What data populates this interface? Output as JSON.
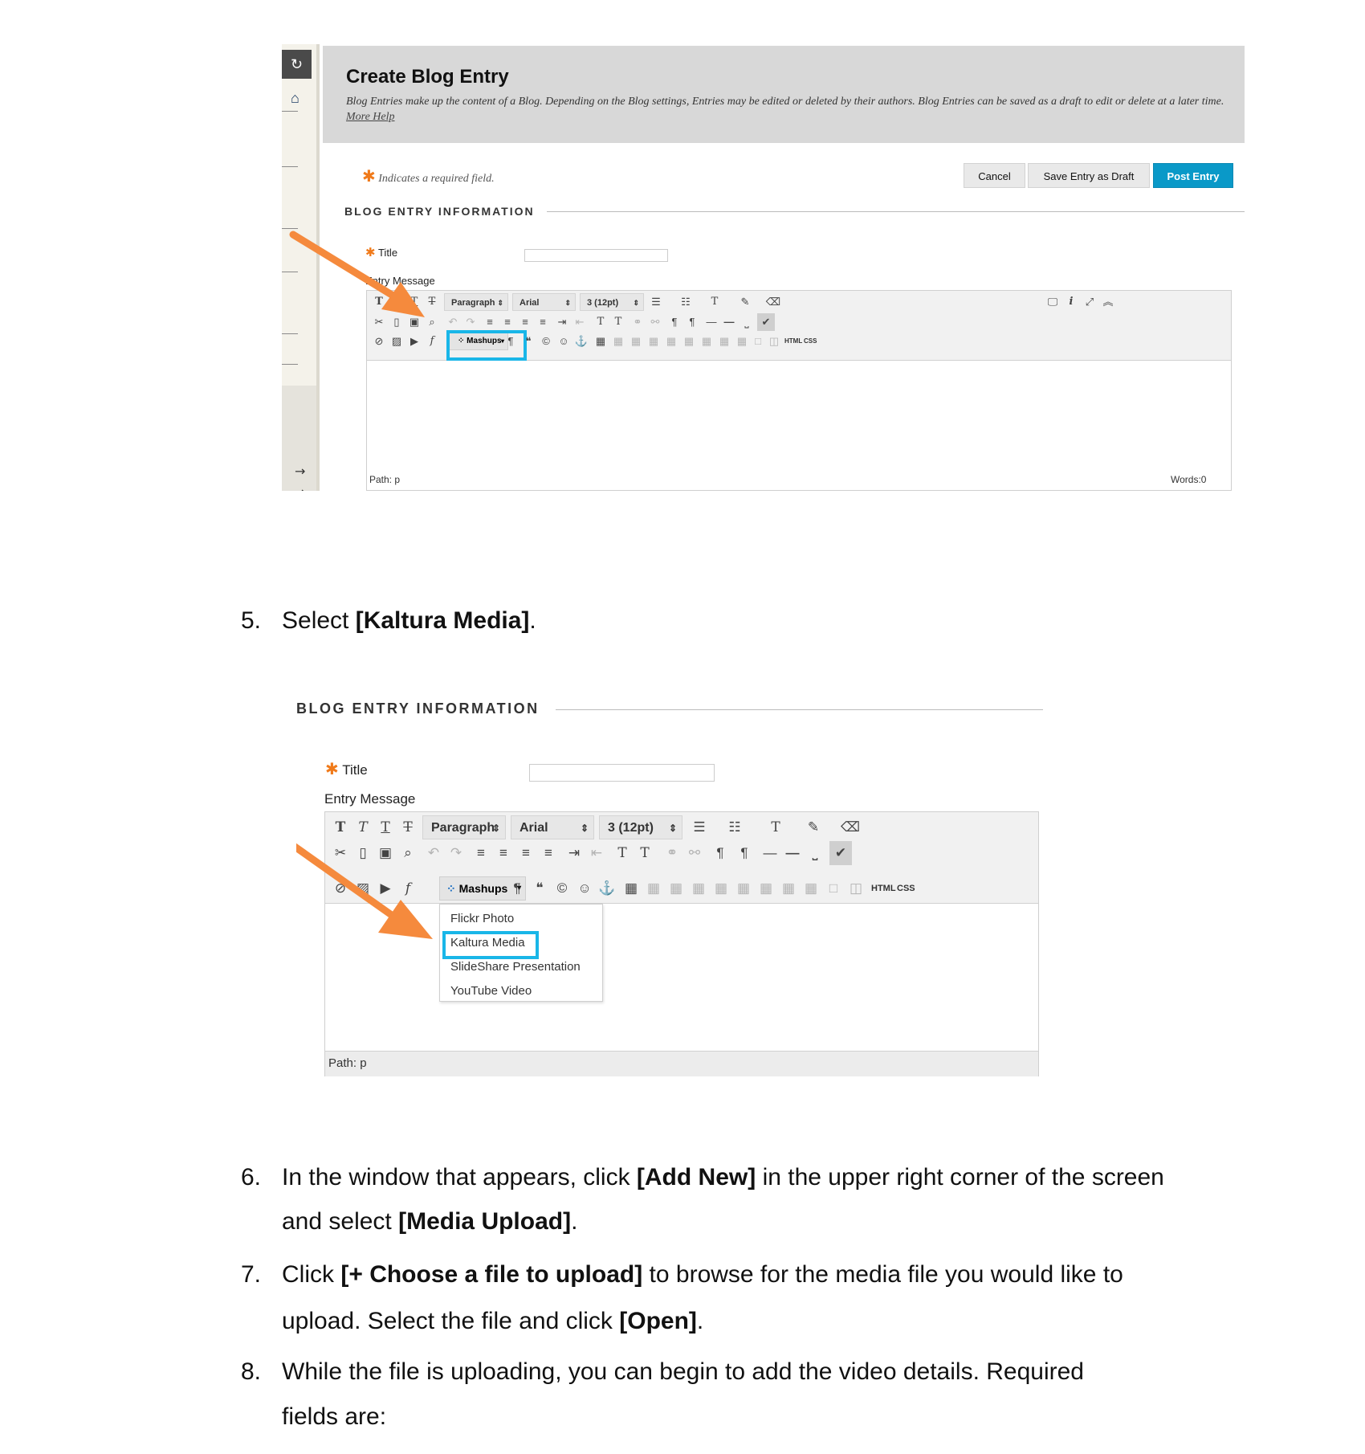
{
  "screenshot1": {
    "refresh_icon": "refresh-icon",
    "home_icon": "home-icon",
    "page_title": "Create Blog Entry",
    "description": "Blog Entries make up the content of a Blog. Depending on the Blog settings, Entries may be edited or deleted by their authors. Blog Entries can be saved as a draft to edit or delete at a later time.",
    "more_help": "More Help",
    "required_note": "Indicates a required field.",
    "buttons": {
      "cancel": "Cancel",
      "save_draft": "Save Entry as Draft",
      "post": "Post Entry"
    },
    "section_title": "BLOG ENTRY INFORMATION",
    "title_label": "Title",
    "entry_message_label": "Entry Message",
    "toolbar": {
      "paragraph": "Paragraph",
      "font": "Arial",
      "size": "3 (12pt)",
      "mashups": "Mashups",
      "html": "HTML",
      "css": "CSS"
    },
    "path": "Path: p",
    "words": "Words:0",
    "highlight_color": "#19b6e8",
    "arrow_color": "#f58a3d",
    "post_button_color": "#0a99c8"
  },
  "steps": {
    "step5": {
      "num": "5.",
      "pre": "Select ",
      "bold": "[Kaltura Media]",
      "post": "."
    },
    "step6": {
      "num": "6.",
      "pre": "In the window that appears, click ",
      "bold1": "[Add New]",
      "mid": " in the upper right corner of the screen and select ",
      "bold2": "[Media Upload]",
      "post": "."
    },
    "step7": {
      "num": "7.",
      "pre": "Click ",
      "bold1": "[+ Choose a file to upload]",
      "mid": " to browse for the media file you would like to upload. Select the file and click ",
      "bold2": "[Open]",
      "post": "."
    },
    "step8": {
      "num": "8.",
      "text": "While the file is uploading, you can begin to add the video details. Required fields are:"
    }
  },
  "screenshot2": {
    "section_title": "BLOG ENTRY INFORMATION",
    "title_label": "Title",
    "entry_message_label": "Entry Message",
    "toolbar": {
      "paragraph": "Paragraph",
      "font": "Arial",
      "size": "3 (12pt)",
      "mashups": "Mashups",
      "html": "HTML",
      "css": "CSS"
    },
    "dropdown": [
      "Flickr Photo",
      "Kaltura Media",
      "SlideShare Presentation",
      "YouTube Video"
    ],
    "path": "Path: p"
  }
}
